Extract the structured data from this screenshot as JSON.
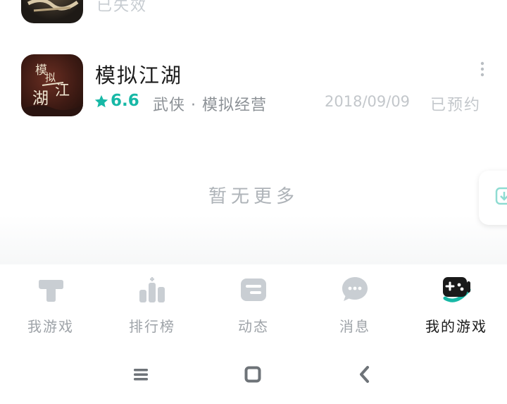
{
  "games": [
    {
      "status": "已失效"
    },
    {
      "title": "模拟江湖",
      "icon_text": "模拟江湖",
      "rating": "6.6",
      "tags": "武侠 · 模拟经营",
      "date": "2018/09/09",
      "status": "已预约"
    }
  ],
  "list_end_text": "暂无更多",
  "tabs": [
    {
      "label": "我游戏",
      "icon": "game-tag-icon",
      "active": false
    },
    {
      "label": "排行榜",
      "icon": "ranking-icon",
      "active": false
    },
    {
      "label": "动态",
      "icon": "feed-icon",
      "active": false
    },
    {
      "label": "消息",
      "icon": "message-icon",
      "active": false
    },
    {
      "label": "我的游戏",
      "icon": "gamepad-icon",
      "active": true
    }
  ],
  "colors": {
    "accent": "#17b8a6",
    "text_primary": "#1d1d1d",
    "text_muted": "#8c9196",
    "text_faint": "#c3c7cb"
  },
  "system_nav": [
    "menu-icon",
    "home-icon",
    "back-icon"
  ]
}
